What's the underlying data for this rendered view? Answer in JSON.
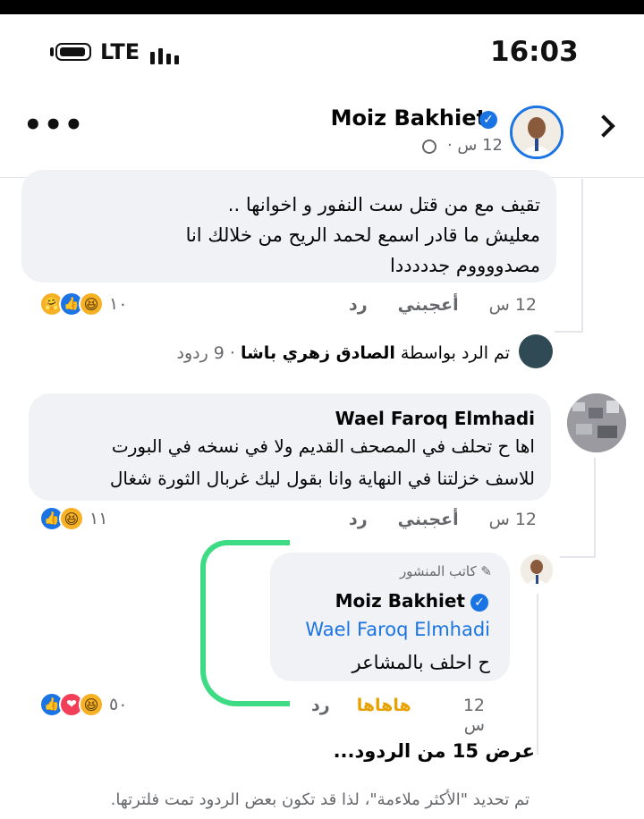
{
  "status_bar": {
    "network": "LTE",
    "time": "16:03"
  },
  "header": {
    "name": "Moiz Bakhiet",
    "meta": "12 س ·"
  },
  "comment1": {
    "lines": [
      "تقيف مع من قتل ست النفور و اخوانها ..",
      "معليش ما قادر اسمع لحمد الريح من خلالك انا",
      "مصدووووم جدددددا"
    ],
    "time": "12 س",
    "like": "أعجبني",
    "reply": "رد",
    "reactions_count": "١٠"
  },
  "replies_summary": {
    "prefix": "تم الرد بواسطة",
    "name": "الصادق زهري باشا",
    "count": "· 9 ردود"
  },
  "comment2": {
    "author": "Wael Faroq Elmhadi",
    "lines": [
      "اها ح تحلف في المصحف القديم ولا في نسخه في البورت",
      "للاسف  خزلتنا في النهاية وانا بقول ليك غربال الثورة شغال"
    ],
    "time": "12 س",
    "like": "أعجبني",
    "reply": "رد",
    "reactions_count": "١١"
  },
  "reply1": {
    "badge": "كاتب المنشور",
    "author": "Moiz Bakhiet",
    "mention": "Wael Faroq Elmhadi",
    "text": "ح احلف بالمشاعر",
    "time": "12 س",
    "reaction_label": "هاهاها",
    "reply": "رد",
    "reactions_count": "٥٠"
  },
  "view_more": "عرض 15 من الردود...",
  "footer_note": "تم تحديد \"الأكثر ملاءمة\"، لذا قد تكون بعض الردود تمت فلترتها.",
  "colors": {
    "accent": "#1b74e4",
    "haha": "#e7a100",
    "highlight": "#3ddc84"
  }
}
